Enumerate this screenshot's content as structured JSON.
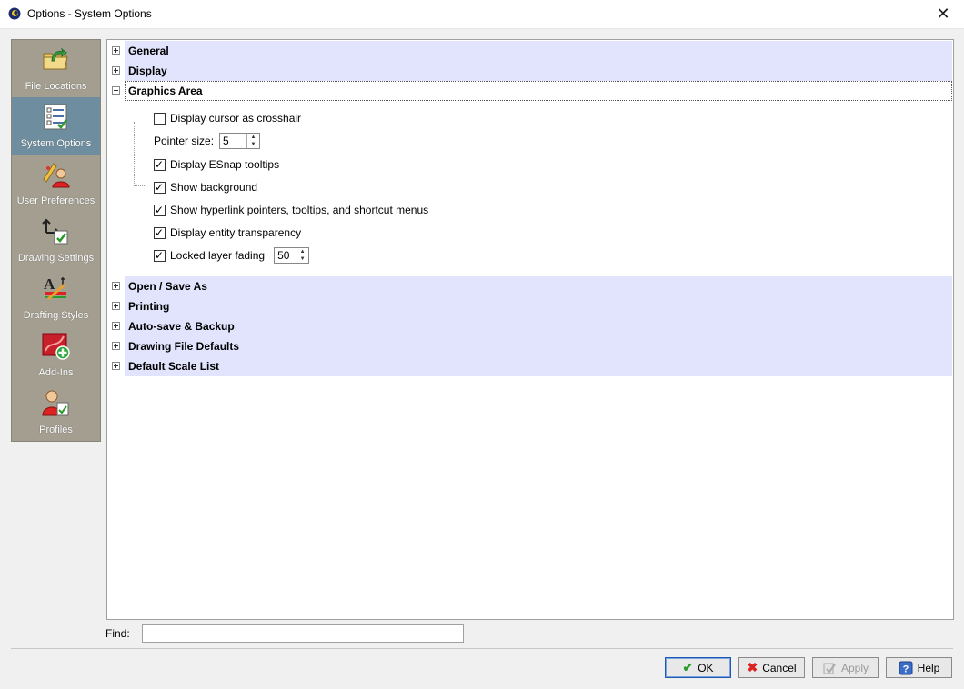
{
  "window": {
    "title": "Options - System Options",
    "close_glyph": "✕"
  },
  "sidebar": {
    "items": [
      {
        "label": "File Locations",
        "icon": "folder-arrow-icon",
        "active": false
      },
      {
        "label": "System Options",
        "icon": "checklist-icon",
        "active": true
      },
      {
        "label": "User Preferences",
        "icon": "user-preferences-icon",
        "active": false
      },
      {
        "label": "Drawing Settings",
        "icon": "drawing-settings-icon",
        "active": false
      },
      {
        "label": "Drafting Styles",
        "icon": "drafting-styles-icon",
        "active": false
      },
      {
        "label": "Add-Ins",
        "icon": "add-ins-icon",
        "active": false
      },
      {
        "label": "Profiles",
        "icon": "profiles-icon",
        "active": false
      }
    ]
  },
  "tree": {
    "sections_top": [
      {
        "label": "General",
        "expanded": false
      },
      {
        "label": "Display",
        "expanded": false
      },
      {
        "label": "Graphics Area",
        "expanded": true
      }
    ],
    "graphics_area": {
      "display_cursor_crosshair": {
        "label": "Display cursor as crosshair",
        "checked": false
      },
      "pointer_size": {
        "label": "Pointer size:",
        "value": "5"
      },
      "display_esnap_tooltips": {
        "label": "Display ESnap tooltips",
        "checked": true
      },
      "show_background": {
        "label": "Show background",
        "checked": true
      },
      "show_hyperlink": {
        "label": "Show hyperlink pointers, tooltips, and shortcut menus",
        "checked": true
      },
      "display_entity_transparency": {
        "label": "Display entity transparency",
        "checked": true
      },
      "locked_layer_fading": {
        "label": "Locked layer fading",
        "checked": true,
        "value": "50"
      }
    },
    "sections_bottom": [
      {
        "label": "Open / Save As",
        "expanded": false
      },
      {
        "label": "Printing",
        "expanded": false
      },
      {
        "label": "Auto-save & Backup",
        "expanded": false
      },
      {
        "label": "Drawing File Defaults",
        "expanded": false
      },
      {
        "label": "Default Scale List",
        "expanded": false
      }
    ]
  },
  "find": {
    "label": "Find:",
    "value": ""
  },
  "buttons": {
    "ok": "OK",
    "cancel": "Cancel",
    "apply": "Apply",
    "help": "Help"
  },
  "colors": {
    "sidebar_bg": "#a39e90",
    "sidebar_active": "#6e8e9f",
    "section_bg": "#e1e4fc",
    "ok_accent": "#1e5ab4"
  }
}
